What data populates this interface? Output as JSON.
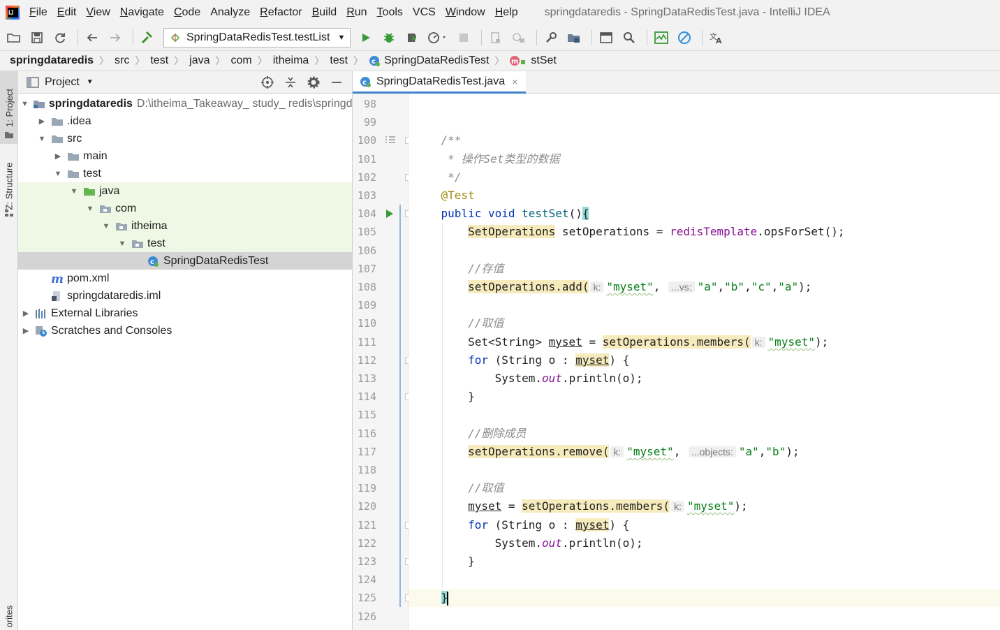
{
  "window_title": "springdataredis - SpringDataRedisTest.java - IntelliJ IDEA",
  "menu": [
    {
      "label": "File",
      "mnemonic": "F",
      "rest": "ile"
    },
    {
      "label": "Edit",
      "mnemonic": "E",
      "rest": "dit"
    },
    {
      "label": "View",
      "mnemonic": "V",
      "rest": "iew"
    },
    {
      "label": "Navigate",
      "mnemonic": "N",
      "rest": "avigate"
    },
    {
      "label": "Code",
      "mnemonic": "C",
      "rest": "ode"
    },
    {
      "label": "Analyze",
      "mnemonic": "",
      "rest": "Analyze"
    },
    {
      "label": "Refactor",
      "mnemonic": "R",
      "rest": "efactor"
    },
    {
      "label": "Build",
      "mnemonic": "B",
      "rest": "uild"
    },
    {
      "label": "Run",
      "mnemonic": "R",
      "rest": "un"
    },
    {
      "label": "Tools",
      "mnemonic": "T",
      "rest": "ools"
    },
    {
      "label": "VCS",
      "mnemonic": "",
      "rest": "VCS"
    },
    {
      "label": "Window",
      "mnemonic": "W",
      "rest": "indow"
    },
    {
      "label": "Help",
      "mnemonic": "H",
      "rest": "elp"
    }
  ],
  "toolbar": {
    "run_config": "SpringDataRedisTest.testList"
  },
  "breadcrumb": [
    {
      "label": "springdataredis",
      "icon": ""
    },
    {
      "label": "src",
      "icon": ""
    },
    {
      "label": "test",
      "icon": ""
    },
    {
      "label": "java",
      "icon": ""
    },
    {
      "label": "com",
      "icon": ""
    },
    {
      "label": "itheima",
      "icon": ""
    },
    {
      "label": "test",
      "icon": ""
    },
    {
      "label": "SpringDataRedisTest",
      "icon": "class-icon"
    },
    {
      "label": "stSet",
      "icon": "method-icon"
    }
  ],
  "left_strip": {
    "project_tab": "1: Project",
    "structure_tab": "Z: Structure",
    "favorites_tab": "orites"
  },
  "project_panel": {
    "title": "Project",
    "tree": [
      {
        "label": "springdataredis",
        "path": "D:\\itheima_Takeaway_ study_ redis\\springd",
        "depth": 0,
        "arrow": "down",
        "icon": "module-folder-icon",
        "bold": true,
        "style": ""
      },
      {
        "label": ".idea",
        "path": "",
        "depth": 1,
        "arrow": "right",
        "icon": "folder-icon",
        "bold": false,
        "style": ""
      },
      {
        "label": "src",
        "path": "",
        "depth": 1,
        "arrow": "down",
        "icon": "folder-icon",
        "bold": false,
        "style": ""
      },
      {
        "label": "main",
        "path": "",
        "depth": 2,
        "arrow": "right",
        "icon": "folder-icon",
        "bold": false,
        "style": ""
      },
      {
        "label": "test",
        "path": "",
        "depth": 2,
        "arrow": "down",
        "icon": "folder-icon",
        "bold": false,
        "style": ""
      },
      {
        "label": "java",
        "path": "",
        "depth": 3,
        "arrow": "down",
        "icon": "test-root-folder-icon",
        "bold": false,
        "style": "green"
      },
      {
        "label": "com",
        "path": "",
        "depth": 4,
        "arrow": "down",
        "icon": "package-icon",
        "bold": false,
        "style": "green"
      },
      {
        "label": "itheima",
        "path": "",
        "depth": 5,
        "arrow": "down",
        "icon": "package-icon",
        "bold": false,
        "style": "green"
      },
      {
        "label": "test",
        "path": "",
        "depth": 6,
        "arrow": "down",
        "icon": "package-icon",
        "bold": false,
        "style": "green"
      },
      {
        "label": "SpringDataRedisTest",
        "path": "",
        "depth": 7,
        "arrow": "",
        "icon": "class-icon",
        "bold": false,
        "style": "selected"
      },
      {
        "label": "pom.xml",
        "path": "",
        "depth": 1,
        "arrow": "",
        "icon": "maven-icon",
        "bold": false,
        "style": ""
      },
      {
        "label": "springdataredis.iml",
        "path": "",
        "depth": 1,
        "arrow": "",
        "icon": "iml-file-icon",
        "bold": false,
        "style": ""
      },
      {
        "label": "External Libraries",
        "path": "",
        "depth": 0,
        "arrow": "right",
        "icon": "library-icon",
        "bold": false,
        "style": ""
      },
      {
        "label": "Scratches and Consoles",
        "path": "",
        "depth": 0,
        "arrow": "right",
        "icon": "scratches-icon",
        "bold": false,
        "style": ""
      }
    ]
  },
  "editor": {
    "tab_label": "SpringDataRedisTest.java",
    "tab_close": "×",
    "lines": [
      {
        "no": "98",
        "tokens": []
      },
      {
        "no": "99",
        "tokens": []
      },
      {
        "no": "100",
        "tokens": [
          {
            "t": "    ",
            "c": ""
          },
          {
            "t": "/**",
            "c": "cm"
          }
        ]
      },
      {
        "no": "101",
        "tokens": [
          {
            "t": "     ",
            "c": ""
          },
          {
            "t": "* 操作Set类型的数据",
            "c": "cm"
          }
        ]
      },
      {
        "no": "102",
        "tokens": [
          {
            "t": "     ",
            "c": ""
          },
          {
            "t": "*/",
            "c": "cm"
          }
        ]
      },
      {
        "no": "103",
        "tokens": [
          {
            "t": "    ",
            "c": ""
          },
          {
            "t": "@Test",
            "c": "an"
          }
        ]
      },
      {
        "no": "104",
        "tokens": [
          {
            "t": "    ",
            "c": ""
          },
          {
            "t": "public void ",
            "c": "kw"
          },
          {
            "t": "testSet",
            "c": "fn"
          },
          {
            "t": "()",
            "c": ""
          },
          {
            "t": "{",
            "c": "brace-hl"
          }
        ]
      },
      {
        "no": "105",
        "tokens": [
          {
            "t": "        ",
            "c": ""
          },
          {
            "t": "SetOperations",
            "c": "hl"
          },
          {
            "t": " setOperations = ",
            "c": ""
          },
          {
            "t": "redisTemplate",
            "c": "fld"
          },
          {
            "t": ".opsForSet();",
            "c": ""
          }
        ]
      },
      {
        "no": "106",
        "tokens": []
      },
      {
        "no": "107",
        "tokens": [
          {
            "t": "        ",
            "c": ""
          },
          {
            "t": "//存值",
            "c": "cm"
          }
        ]
      },
      {
        "no": "108",
        "tokens": [
          {
            "t": "        ",
            "c": ""
          },
          {
            "t": "setOperations.add(",
            "c": "hl"
          },
          {
            "t": "k:",
            "c": "hint"
          },
          {
            "t": "\"myset\"",
            "c": "st wav"
          },
          {
            "t": ", ",
            "c": ""
          },
          {
            "t": "...vs:",
            "c": "hint"
          },
          {
            "t": "\"a\"",
            "c": "st"
          },
          {
            "t": ",",
            "c": ""
          },
          {
            "t": "\"b\"",
            "c": "st"
          },
          {
            "t": ",",
            "c": ""
          },
          {
            "t": "\"c\"",
            "c": "st"
          },
          {
            "t": ",",
            "c": ""
          },
          {
            "t": "\"a\"",
            "c": "st"
          },
          {
            "t": ");",
            "c": ""
          }
        ]
      },
      {
        "no": "109",
        "tokens": []
      },
      {
        "no": "110",
        "tokens": [
          {
            "t": "        ",
            "c": ""
          },
          {
            "t": "//取值",
            "c": "cm"
          }
        ]
      },
      {
        "no": "111",
        "tokens": [
          {
            "t": "        ",
            "c": ""
          },
          {
            "t": "Set<String> ",
            "c": ""
          },
          {
            "t": "myset",
            "c": "ul"
          },
          {
            "t": " = ",
            "c": ""
          },
          {
            "t": "setOperations.members(",
            "c": "hl"
          },
          {
            "t": "k:",
            "c": "hint"
          },
          {
            "t": "\"myset\"",
            "c": "st wav"
          },
          {
            "t": ");",
            "c": ""
          }
        ]
      },
      {
        "no": "112",
        "tokens": [
          {
            "t": "        ",
            "c": ""
          },
          {
            "t": "for",
            "c": "kw"
          },
          {
            "t": " (String o : ",
            "c": ""
          },
          {
            "t": "myset",
            "c": "hl ul"
          },
          {
            "t": ") {",
            "c": ""
          }
        ]
      },
      {
        "no": "113",
        "tokens": [
          {
            "t": "            System.",
            "c": ""
          },
          {
            "t": "out",
            "c": "sfld"
          },
          {
            "t": ".println(o);",
            "c": ""
          }
        ]
      },
      {
        "no": "114",
        "tokens": [
          {
            "t": "        }",
            "c": ""
          }
        ]
      },
      {
        "no": "115",
        "tokens": []
      },
      {
        "no": "116",
        "tokens": [
          {
            "t": "        ",
            "c": ""
          },
          {
            "t": "//删除成员",
            "c": "cm"
          }
        ]
      },
      {
        "no": "117",
        "tokens": [
          {
            "t": "        ",
            "c": ""
          },
          {
            "t": "setOperations.remove(",
            "c": "hl"
          },
          {
            "t": "k:",
            "c": "hint"
          },
          {
            "t": "\"myset\"",
            "c": "st wav"
          },
          {
            "t": ", ",
            "c": ""
          },
          {
            "t": "...objects:",
            "c": "hint"
          },
          {
            "t": "\"a\"",
            "c": "st"
          },
          {
            "t": ",",
            "c": ""
          },
          {
            "t": "\"b\"",
            "c": "st"
          },
          {
            "t": ");",
            "c": ""
          }
        ]
      },
      {
        "no": "118",
        "tokens": []
      },
      {
        "no": "119",
        "tokens": [
          {
            "t": "        ",
            "c": ""
          },
          {
            "t": "//取值",
            "c": "cm"
          }
        ]
      },
      {
        "no": "120",
        "tokens": [
          {
            "t": "        ",
            "c": ""
          },
          {
            "t": "myset",
            "c": "ul"
          },
          {
            "t": " = ",
            "c": ""
          },
          {
            "t": "setOperations.members(",
            "c": "hl"
          },
          {
            "t": "k:",
            "c": "hint"
          },
          {
            "t": "\"myset\"",
            "c": "st wav"
          },
          {
            "t": ");",
            "c": ""
          }
        ]
      },
      {
        "no": "121",
        "tokens": [
          {
            "t": "        ",
            "c": ""
          },
          {
            "t": "for",
            "c": "kw"
          },
          {
            "t": " (String o : ",
            "c": ""
          },
          {
            "t": "myset",
            "c": "hl ul"
          },
          {
            "t": ") {",
            "c": ""
          }
        ]
      },
      {
        "no": "122",
        "tokens": [
          {
            "t": "            System.",
            "c": ""
          },
          {
            "t": "out",
            "c": "sfld"
          },
          {
            "t": ".println(o);",
            "c": ""
          }
        ]
      },
      {
        "no": "123",
        "tokens": [
          {
            "t": "        }",
            "c": ""
          }
        ]
      },
      {
        "no": "124",
        "tokens": []
      },
      {
        "no": "125",
        "tokens": [
          {
            "t": "    ",
            "c": ""
          },
          {
            "t": "}",
            "c": "brace-hl caret-after"
          }
        ],
        "current": true
      },
      {
        "no": "126",
        "tokens": []
      }
    ]
  },
  "colors": {
    "accent": "#4083c9",
    "keyword": "#0033b3",
    "string": "#067d17",
    "comment": "#8c8c8c",
    "annotation": "#9e880d",
    "highlight": "#f6ebbc",
    "test_folder_bg": "#eef8e4"
  }
}
